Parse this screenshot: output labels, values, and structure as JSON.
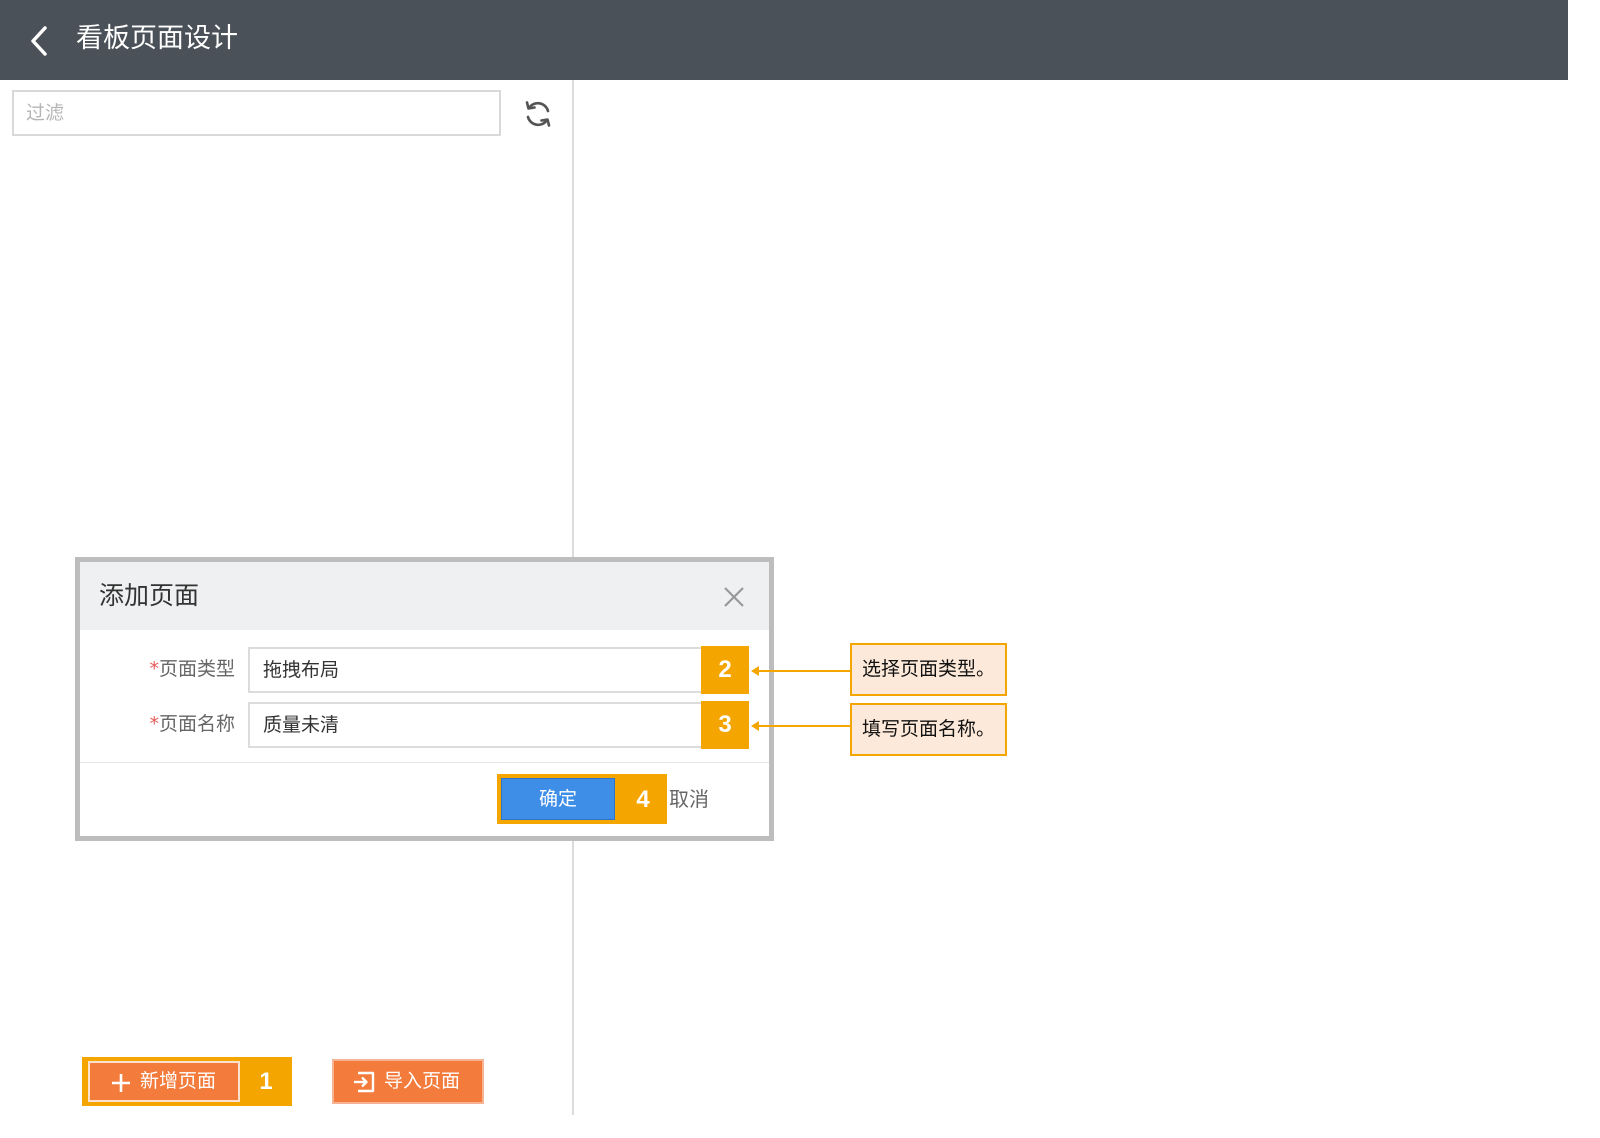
{
  "header": {
    "title": "看板页面设计",
    "back_icon": "chevron-left-icon"
  },
  "sidebar": {
    "filter_placeholder": "过滤",
    "refresh_icon": "refresh-icon",
    "add_page_label": "新增页面",
    "add_page_icon": "plus-icon",
    "import_page_label": "导入页面",
    "import_page_icon": "import-icon"
  },
  "dialog": {
    "title": "添加页面",
    "close_icon": "close-icon",
    "required_mark": "*",
    "fields": [
      {
        "label": "页面类型",
        "value": "拖拽布局"
      },
      {
        "label": "页面名称",
        "value": "质量未清"
      }
    ],
    "confirm_label": "确定",
    "cancel_label": "取消"
  },
  "annotations": {
    "steps": [
      "1",
      "2",
      "3",
      "4"
    ],
    "callouts": [
      "选择页面类型。",
      "填写页面名称。"
    ]
  },
  "colors": {
    "header_bg": "#4b5158",
    "highlight": "#f5a500",
    "callout_bg": "#fde9d9",
    "primary_button": "#3e8ee8",
    "action_button": "#f37b3c"
  }
}
